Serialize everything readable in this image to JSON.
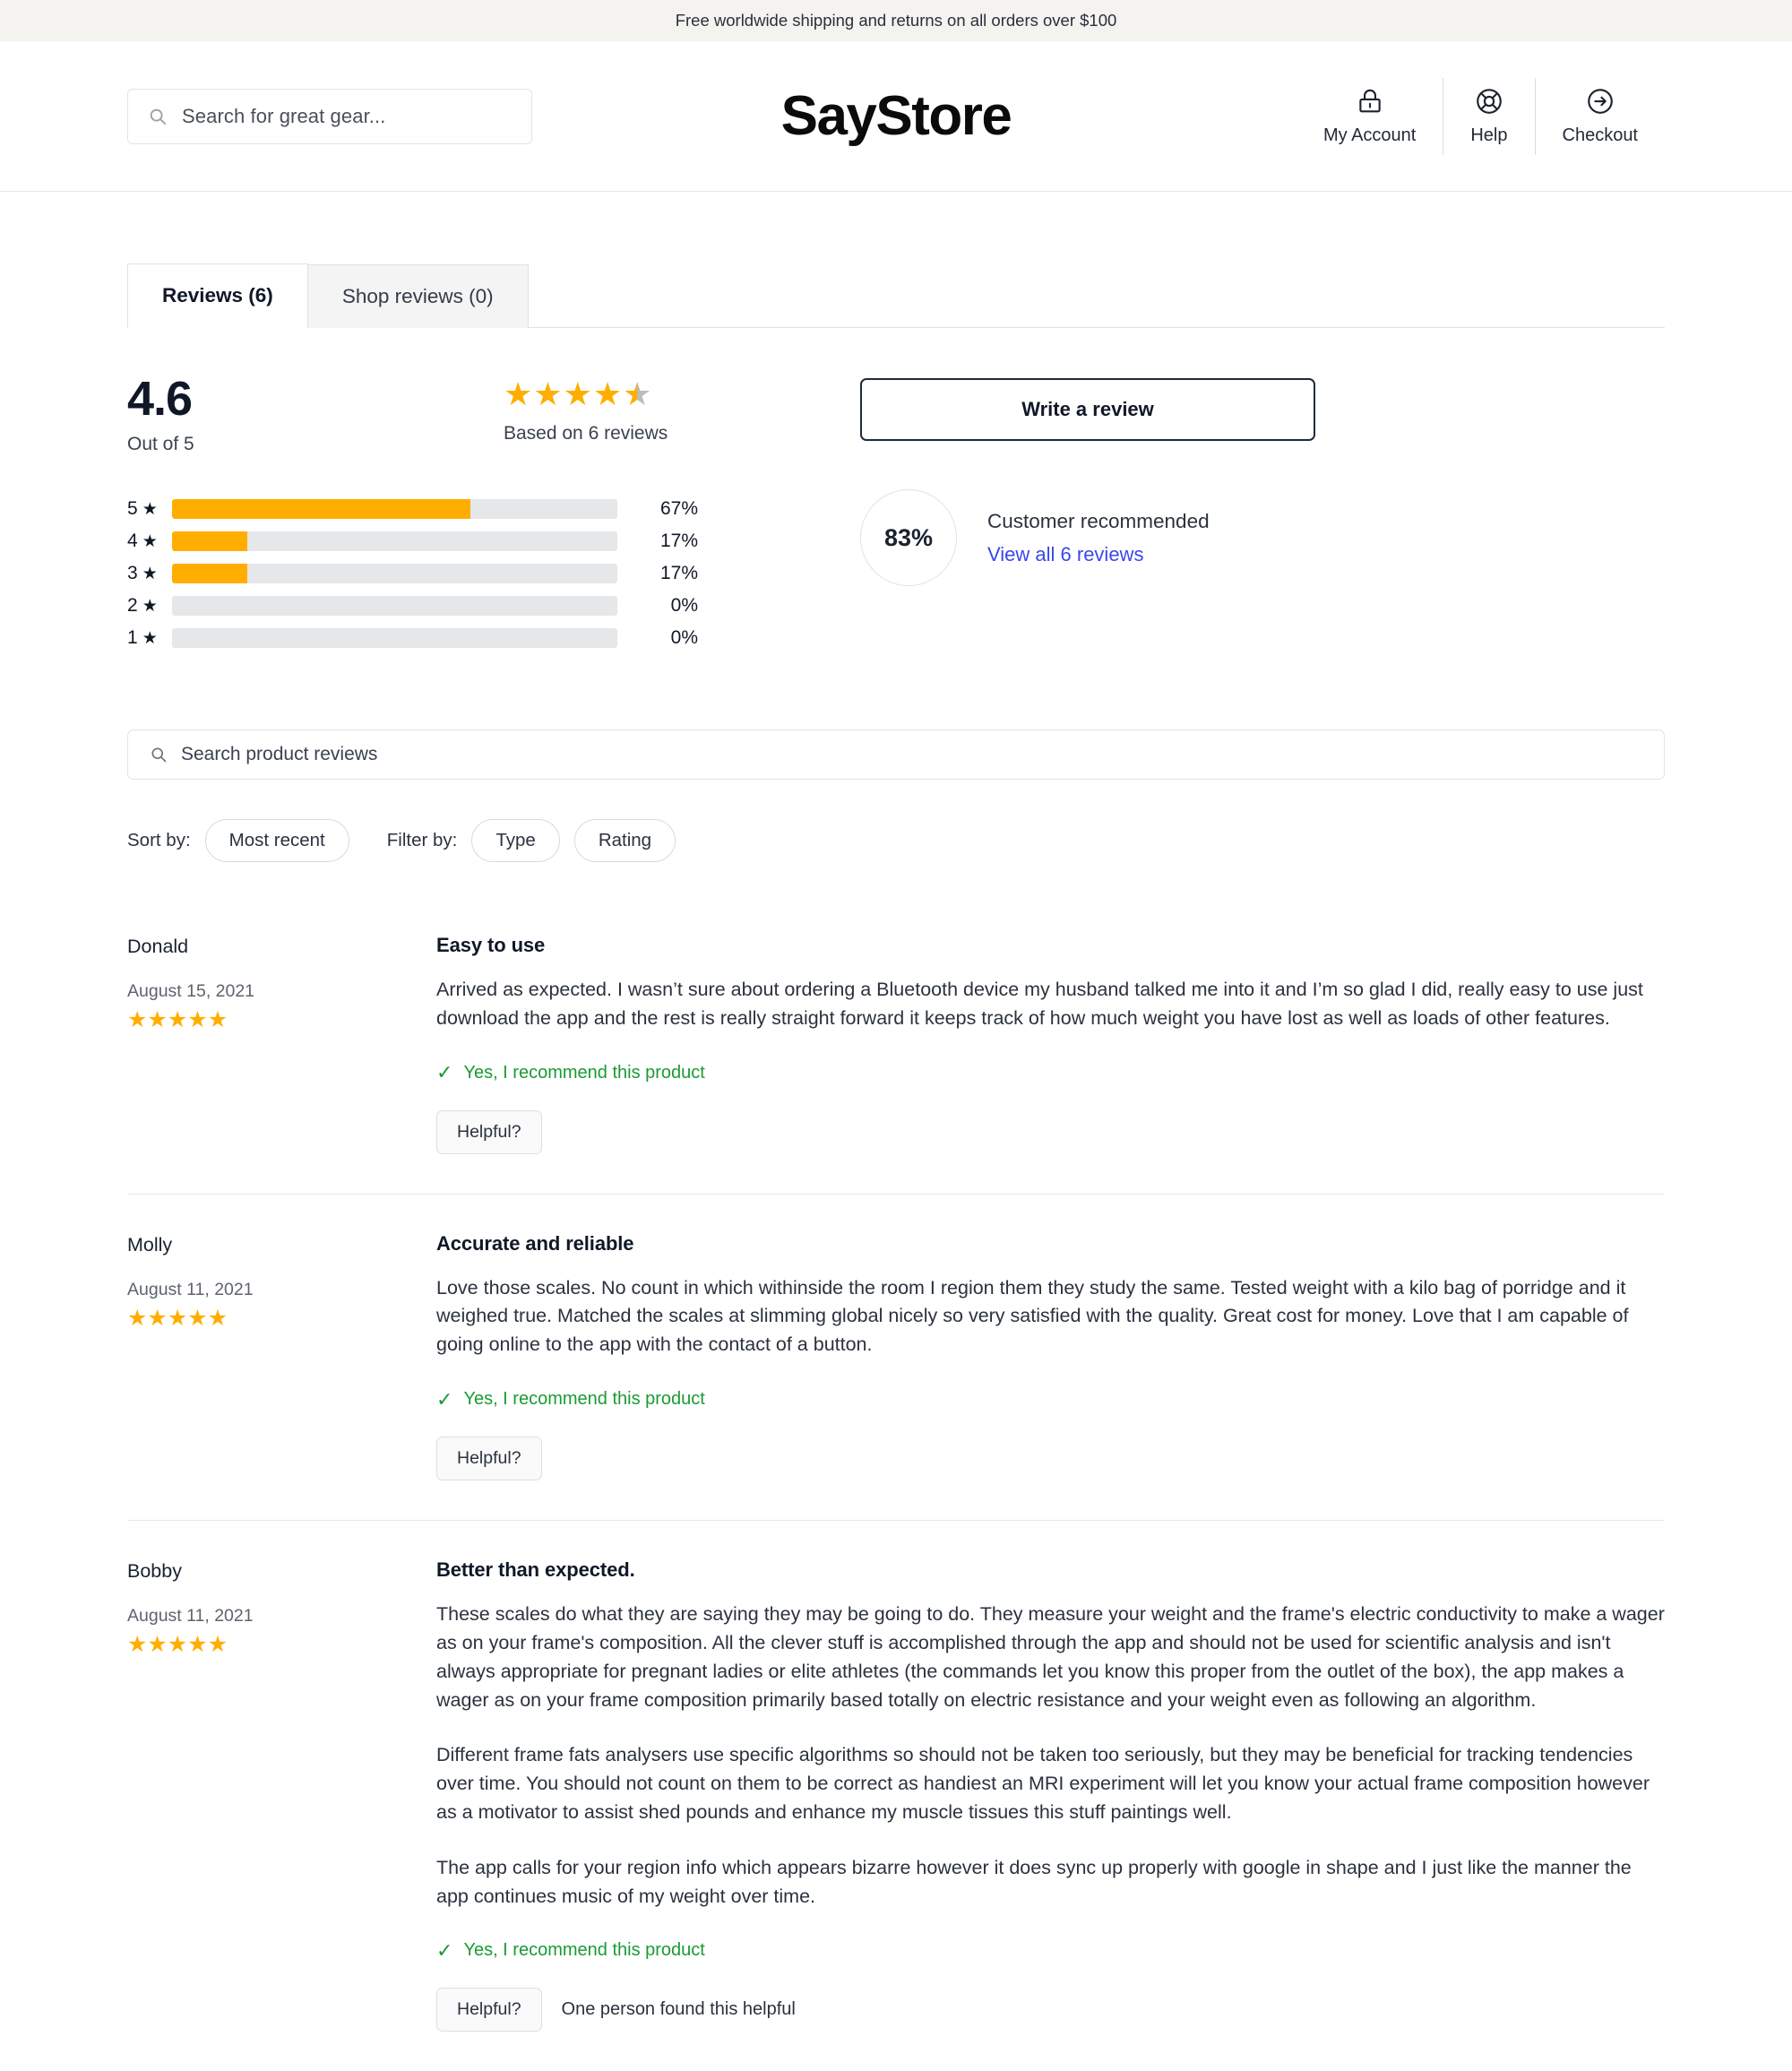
{
  "announcement": {
    "text": "Free worldwide shipping and returns on all orders over $100"
  },
  "header": {
    "search_placeholder": "Search for great gear...",
    "brand": "SayStore",
    "actions": [
      {
        "label": "My Account",
        "icon": "lock-icon"
      },
      {
        "label": "Help",
        "icon": "lifebuoy-icon"
      },
      {
        "label": "Checkout",
        "icon": "arrow-right-circle-icon"
      }
    ]
  },
  "tabs": [
    {
      "label": "Reviews (6)",
      "active": true
    },
    {
      "label": "Shop reviews (0)",
      "active": false
    }
  ],
  "summary": {
    "score": "4.6",
    "score_sub": "Out of 5",
    "stars_filled": 4,
    "stars_half": true,
    "based_on": "Based on 6 reviews",
    "write_review_label": "Write a review",
    "recommend_percent": "83%",
    "recommend_label": "Customer recommended",
    "view_all_label": "View all 6 reviews",
    "histogram": [
      {
        "label": "5",
        "pct": "67%",
        "value": 67
      },
      {
        "label": "4",
        "pct": "17%",
        "value": 17
      },
      {
        "label": "3",
        "pct": "17%",
        "value": 17
      },
      {
        "label": "2",
        "pct": "0%",
        "value": 0
      },
      {
        "label": "1",
        "pct": "0%",
        "value": 0
      }
    ]
  },
  "review_search": {
    "placeholder": "Search product reviews"
  },
  "filters": {
    "sort_label": "Sort by:",
    "sort_value": "Most recent",
    "filter_label": "Filter by:",
    "chips": [
      "Type",
      "Rating"
    ]
  },
  "reviews": [
    {
      "name": "Donald",
      "date": "August 15, 2021",
      "stars": 5,
      "title": "Easy to use",
      "paragraphs": [
        "Arrived as expected. I wasn’t sure about ordering a Bluetooth device my husband talked me into it and I’m so glad I did, really easy to use just download the app and the rest is really straight forward it keeps track of how much weight you have lost as well as loads of other features."
      ],
      "recommend": "Yes, I recommend this product",
      "helpful_label": "Helpful?",
      "helpful_count": ""
    },
    {
      "name": "Molly",
      "date": "August 11, 2021",
      "stars": 5,
      "title": "Accurate and reliable",
      "paragraphs": [
        "Love those scales. No count in which withinside the room I region them they study the same. Tested weight with a kilo bag of porridge and it weighed true. Matched the scales at slimming global nicely so very satisfied with the quality. Great cost for money. Love that I am capable of going online to the app with the contact of a button."
      ],
      "recommend": "Yes, I recommend this product",
      "helpful_label": "Helpful?",
      "helpful_count": ""
    },
    {
      "name": "Bobby",
      "date": "August 11, 2021",
      "stars": 5,
      "title": "Better than expected.",
      "paragraphs": [
        "These scales do what they are saying they may be going to do. They measure your weight and the frame's electric conductivity to make a wager as on your frame's composition. All the clever stuff is accomplished through the app and should not be used for scientific analysis and isn't always appropriate for pregnant ladies or elite athletes (the commands let you know this proper from the outlet of the box), the app makes a wager as on your frame composition primarily based totally on electric resistance and your weight even as following an algorithm.",
        "Different frame fats analysers use specific algorithms so should not be taken too seriously, but they may be beneficial for tracking tendencies over time. You should not count on them to be correct as handiest an MRI experiment will let you know your actual frame composition however as a motivator to assist shed pounds and enhance my muscle tissues this stuff paintings well.",
        "The app calls for your region info which appears bizarre however it does sync up properly with google in shape and I just like the manner the app continues music of my weight over time."
      ],
      "recommend": "Yes, I recommend this product",
      "helpful_label": "Helpful?",
      "helpful_count": "One person found this helpful"
    }
  ],
  "colors": {
    "star": "#ffae00",
    "track": "#e6e7e9",
    "link": "#3b47ea",
    "recommend_green": "#1a9b34",
    "announce_bg": "#f4f3ef"
  }
}
